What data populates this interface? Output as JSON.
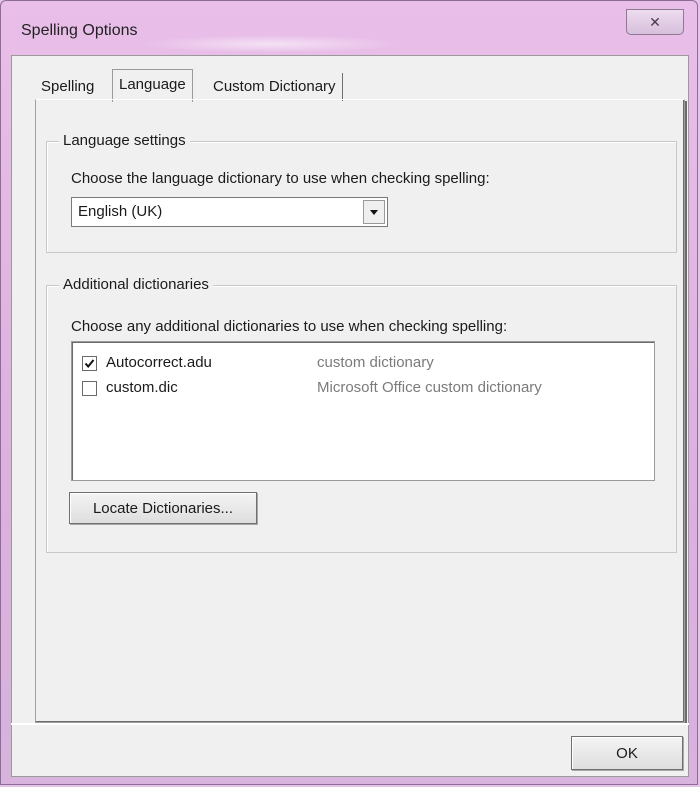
{
  "window": {
    "title": "Spelling Options",
    "close_glyph": "✕"
  },
  "tabs": [
    {
      "label": "Spelling",
      "active": false
    },
    {
      "label": "Language",
      "active": true
    },
    {
      "label": "Custom Dictionary",
      "active": false
    }
  ],
  "language_settings": {
    "legend": "Language settings",
    "prompt": "Choose the language dictionary to use when checking spelling:",
    "selected": "English (UK)"
  },
  "additional_dictionaries": {
    "legend": "Additional dictionaries",
    "prompt": "Choose any additional dictionaries to use when checking spelling:",
    "items": [
      {
        "name": "Autocorrect.adu",
        "description": "custom dictionary",
        "checked": true
      },
      {
        "name": "custom.dic",
        "description": "Microsoft Office custom dictionary",
        "checked": false
      }
    ],
    "locate_button": "Locate Dictionaries..."
  },
  "footer": {
    "ok_button": "OK"
  },
  "colors": {
    "title_bar": "#e3b8e6",
    "dialog_bg": "#f0f0f0"
  }
}
